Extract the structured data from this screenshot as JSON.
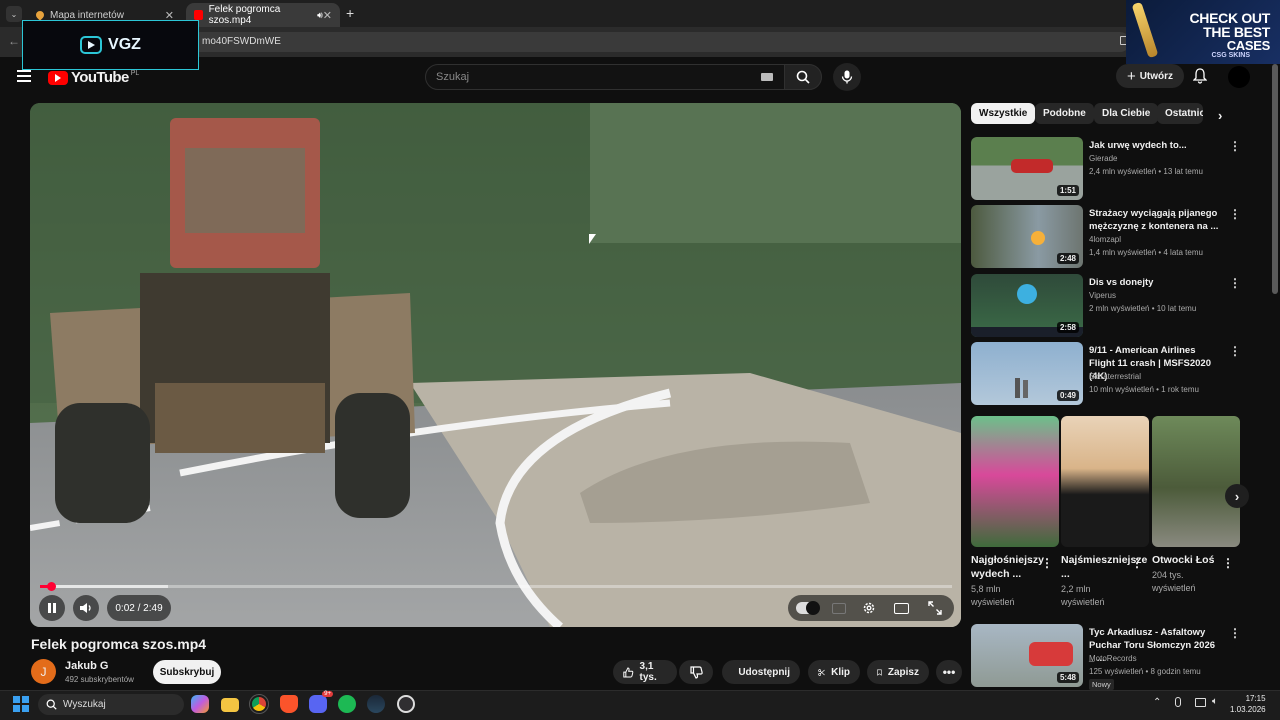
{
  "browser": {
    "tabs": [
      {
        "label": "Mapa internetów"
      },
      {
        "label": "Felek pogromca szos.mp4"
      }
    ],
    "url_fragment": "mo40FSWDmWE"
  },
  "overlays": {
    "vgz_label": "VGZ",
    "ad_line1": "CHECK",
    "ad_line1b": "OUT",
    "ad_line2": "THE BEST",
    "ad_line3": "CASES",
    "ad_brand": "CSG SKINS"
  },
  "header": {
    "logo_text": "YouTube",
    "region": "PL",
    "search_placeholder": "Szukaj",
    "create_label": "Utwórz"
  },
  "player": {
    "time_current": "0:02",
    "time_separator": "/",
    "time_total": "2:49",
    "progress_fraction": 0.012,
    "buffered_fraction": 0.14
  },
  "video": {
    "title": "Felek pogromca szos.mp4",
    "channel_initial": "J",
    "channel_name": "Jakub G",
    "channel_subs": "492 subskrybentów",
    "subscribe_label": "Subskrybuj",
    "likes": "3,1 tys.",
    "share_label": "Udostępnij",
    "clip_label": "Klip",
    "save_label": "Zapisz"
  },
  "chips": [
    {
      "label": "Wszystkie"
    },
    {
      "label": "Podobne"
    },
    {
      "label": "Dla Ciebie"
    },
    {
      "label": "Ostatnio"
    }
  ],
  "recommendations": [
    {
      "title": "Jak urwę wydech to...",
      "channel": "Gierade",
      "meta": "2,4 mln wyświetleń • 13 lat temu",
      "duration": "1:51"
    },
    {
      "title": "Strażacy wyciągają pijanego mężczyznę z kontenera na ...",
      "channel": "4lomzapl",
      "meta": "1,4 mln wyświetleń • 4 lata temu",
      "duration": "2:48"
    },
    {
      "title": "Dis vs donejty",
      "channel": "Viperus",
      "meta": "2 mln wyświetleń • 10 lat temu",
      "duration": "2:58"
    },
    {
      "title": "9/11 - American Airlines Flight 11 crash | MSFS2020 (4K)",
      "channel": "Extraterrestrial",
      "meta": "10 mln wyświetleń • 1 rok temu",
      "duration": "0:49"
    },
    {
      "title": "Tyc Arkadiusz - Asfaltowy Puchar Toru Słomczyn 2026 _ ...",
      "channel": "MotoRecords",
      "meta": "125 wyświetleń • 8 godzin temu",
      "duration": "5:48",
      "badge": "Nowy"
    }
  ],
  "shorts": [
    {
      "title": "Najgłośniejszy wydech ...",
      "views": "5,8 mln wyświetleń"
    },
    {
      "title": "Najśmieszniejsze ...",
      "views": "2,2 mln wyświetleń"
    },
    {
      "title": "Otwocki Łoś",
      "views": "204 tys. wyświetleń"
    }
  ],
  "taskbar": {
    "search_label": "Wyszukaj",
    "time": "17:15",
    "date": "1.03.2026",
    "discord_badge": "9+"
  }
}
